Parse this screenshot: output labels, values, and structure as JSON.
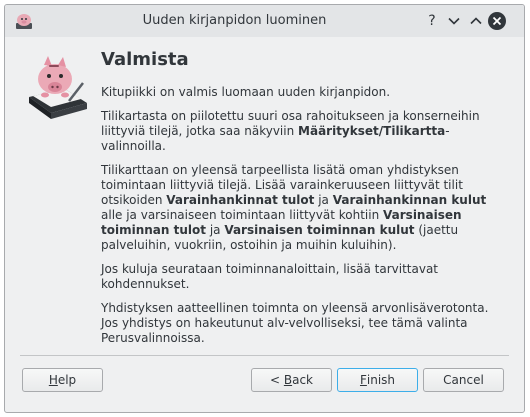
{
  "window": {
    "title": "Uuden kirjanpidon luominen",
    "help_glyph": "?",
    "minimize_glyph": "⌄",
    "maximize_glyph": "⌃",
    "accent": "#3daee9"
  },
  "page": {
    "heading": "Valmista",
    "paragraphs": [
      [
        {
          "t": "Kitupiikki on valmis luomaan uuden kirjanpidon."
        }
      ],
      [
        {
          "t": "Tilikartasta on piilotettu suuri osa rahoitukseen ja konserneihin liittyviä tilejä, jotka saa näkyviin "
        },
        {
          "t": "Määritykset/Tilikartta",
          "b": true
        },
        {
          "t": "-valinnoilla."
        }
      ],
      [
        {
          "t": "Tilikarttaan on yleensä tarpeellista lisätä oman yhdistyksen toimintaan liittyviä tilejä. Lisää varainkeruuseen liittyvät tilit otsikoiden "
        },
        {
          "t": "Varainhankinnat tulot",
          "b": true
        },
        {
          "t": " ja "
        },
        {
          "t": "Varainhankinnan kulut",
          "b": true
        },
        {
          "t": " alle ja varsinaiseen toimintaan liittyvät kohtiin "
        },
        {
          "t": "Varsinaisen toiminnan tulot",
          "b": true
        },
        {
          "t": " ja "
        },
        {
          "t": "Varsinaisen toiminnan kulut",
          "b": true
        },
        {
          "t": " (jaettu palveluihin, vuokriin, ostoihin ja muihin kuluihin)."
        }
      ],
      [
        {
          "t": "Jos kuluja seurataan toiminnanaloittain, lisää tarvittavat kohdennukset."
        }
      ],
      [
        {
          "t": "Yhdistyksen aatteellinen toimnta on yleensä arvonlisäverotonta. Jos yhdistys on hakeutunut alv-velvolliseksi, tee tämä valinta Perusvalinnoissa."
        }
      ]
    ]
  },
  "buttons": {
    "help": {
      "mnemonic": "H",
      "rest": "elp"
    },
    "back": {
      "pre": "< ",
      "mnemonic": "B",
      "rest": "ack"
    },
    "finish": {
      "mnemonic": "F",
      "rest": "inish"
    },
    "cancel": {
      "label": "Cancel"
    }
  },
  "icons": {
    "app": "piggy-bank-app-icon",
    "wizard": "piggy-bank-book-icon"
  }
}
